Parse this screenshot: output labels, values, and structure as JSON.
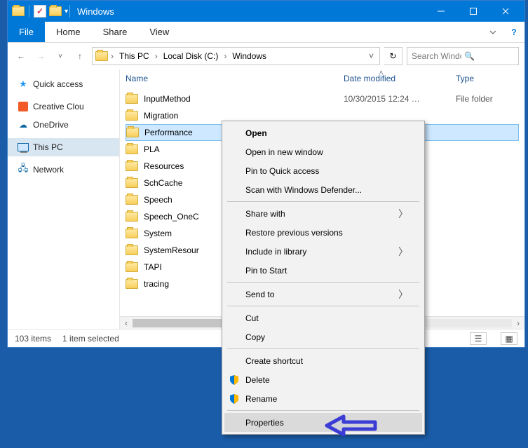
{
  "window": {
    "title": "Windows"
  },
  "ribbon": {
    "file": "File",
    "tabs": [
      "Home",
      "Share",
      "View"
    ]
  },
  "breadcrumb": {
    "items": [
      "This PC",
      "Local Disk (C:)",
      "Windows"
    ]
  },
  "search": {
    "placeholder": "Search Windows"
  },
  "sidebar": {
    "items": [
      {
        "label": "Quick access",
        "icon": "star"
      },
      {
        "label": "Creative Clou",
        "icon": "ccloud"
      },
      {
        "label": "OneDrive",
        "icon": "odrive"
      },
      {
        "label": "This PC",
        "icon": "pc",
        "selected": true
      },
      {
        "label": "Network",
        "icon": "net"
      }
    ]
  },
  "columns": {
    "name": "Name",
    "modified": "Date modified",
    "type": "Type"
  },
  "files": [
    {
      "name": "InputMethod",
      "modified": "10/30/2015 12:24 …",
      "type": "File folder"
    },
    {
      "name": "Migration"
    },
    {
      "name": "Performance",
      "selected": true
    },
    {
      "name": "PLA"
    },
    {
      "name": "Resources"
    },
    {
      "name": "SchCache"
    },
    {
      "name": "Speech"
    },
    {
      "name": "Speech_OneC"
    },
    {
      "name": "System"
    },
    {
      "name": "SystemResour"
    },
    {
      "name": "TAPI"
    },
    {
      "name": "tracing"
    }
  ],
  "status": {
    "count": "103 items",
    "selected": "1 item selected"
  },
  "contextMenu": {
    "groups": [
      [
        {
          "label": "Open",
          "bold": true
        },
        {
          "label": "Open in new window"
        },
        {
          "label": "Pin to Quick access"
        },
        {
          "label": "Scan with Windows Defender..."
        }
      ],
      [
        {
          "label": "Share with",
          "submenu": true
        },
        {
          "label": "Restore previous versions"
        },
        {
          "label": "Include in library",
          "submenu": true
        },
        {
          "label": "Pin to Start"
        }
      ],
      [
        {
          "label": "Send to",
          "submenu": true
        }
      ],
      [
        {
          "label": "Cut"
        },
        {
          "label": "Copy"
        }
      ],
      [
        {
          "label": "Create shortcut"
        },
        {
          "label": "Delete",
          "shield": true
        },
        {
          "label": "Rename",
          "shield": true
        }
      ],
      [
        {
          "label": "Properties",
          "hover": true
        }
      ]
    ]
  }
}
